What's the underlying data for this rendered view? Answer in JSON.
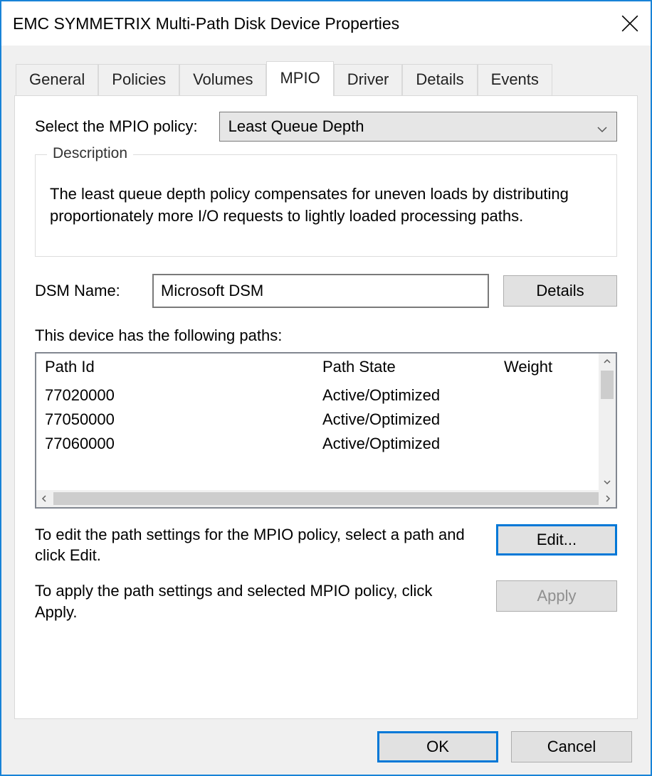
{
  "window": {
    "title": "EMC SYMMETRIX  Multi-Path Disk Device Properties"
  },
  "tabs": [
    {
      "label": "General"
    },
    {
      "label": "Policies"
    },
    {
      "label": "Volumes"
    },
    {
      "label": "MPIO",
      "active": true
    },
    {
      "label": "Driver"
    },
    {
      "label": "Details"
    },
    {
      "label": "Events"
    }
  ],
  "mpio": {
    "policy_label": "Select the MPIO policy:",
    "policy_value": "Least Queue Depth",
    "description_legend": "Description",
    "description_text": "The least queue depth policy compensates for uneven loads by distributing proportionately more I/O requests to lightly loaded processing paths.",
    "dsm_label": "DSM Name:",
    "dsm_value": "Microsoft DSM",
    "details_button": "Details",
    "paths_label": "This device has the following paths:",
    "columns": {
      "path_id": "Path Id",
      "path_state": "Path State",
      "weight": "Weight"
    },
    "paths": [
      {
        "id": "77020000",
        "state": "Active/Optimized"
      },
      {
        "id": "77050000",
        "state": "Active/Optimized"
      },
      {
        "id": "77060000",
        "state": "Active/Optimized"
      }
    ],
    "edit_hint": "To edit the path settings for the MPIO policy, select a path and click Edit.",
    "edit_button": "Edit...",
    "apply_hint": "To apply the path settings and selected MPIO policy, click Apply.",
    "apply_button": "Apply"
  },
  "buttons": {
    "ok": "OK",
    "cancel": "Cancel"
  }
}
